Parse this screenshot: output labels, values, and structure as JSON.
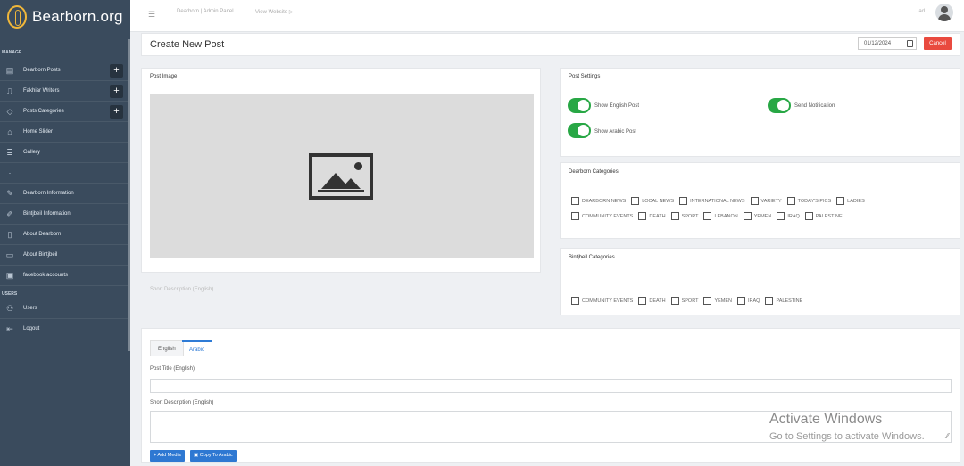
{
  "brand": {
    "name": "Bearborn.org"
  },
  "sidebar": {
    "section_manage": "MANAGE",
    "section_users": "USERS",
    "items": [
      {
        "label": "Dearborn Posts",
        "icon": "posts-icon",
        "has_add": true
      },
      {
        "label": "Fakhiar Writers",
        "icon": "writers-icon",
        "has_add": true
      },
      {
        "label": "Posts Categories",
        "icon": "tag-icon",
        "has_add": true
      },
      {
        "label": "Home Slider",
        "icon": "home-icon",
        "has_add": false
      },
      {
        "label": "Gallery",
        "icon": "gallery-icon",
        "has_add": false
      },
      {
        "label": "",
        "icon": "blank-icon",
        "has_add": false
      },
      {
        "label": "Dearborn Information",
        "icon": "info-icon",
        "has_add": false
      },
      {
        "label": "Bintjbeil Information",
        "icon": "info2-icon",
        "has_add": false
      },
      {
        "label": "About Dearborn",
        "icon": "about-icon",
        "has_add": false
      },
      {
        "label": "About Bintjbeil",
        "icon": "about2-icon",
        "has_add": false
      },
      {
        "label": "facebook accounts",
        "icon": "facebook-icon",
        "has_add": false
      }
    ],
    "users_items": [
      {
        "label": "Users",
        "icon": "users-icon"
      },
      {
        "label": "Logout",
        "icon": "logout-icon"
      }
    ]
  },
  "topbar": {
    "admin_panel": "Dearborn | Admin Panel",
    "view_website": "View Website",
    "user_initials": "ad"
  },
  "header": {
    "title": "Create New Post",
    "date_value": "01/12/2024",
    "cancel_label": "Cancel"
  },
  "post_image": {
    "title": "Post Image",
    "placeholder_icon": "image-placeholder-icon"
  },
  "post_settings": {
    "title": "Post Settings",
    "toggles": [
      {
        "label": "Show English Post",
        "on": true
      },
      {
        "label": "Send Notification",
        "on": true
      },
      {
        "label": "Show Arabic Post",
        "on": true
      }
    ]
  },
  "dearborn_categories": {
    "title": "Dearborn Categories",
    "row1": [
      "DEARBORN NEWS",
      "LOCAL NEWS",
      "INTERNATIONAL NEWS",
      "VARIETY",
      "TODAY'S PICS",
      "LADIES"
    ],
    "row2": [
      "COMMUNITY EVENTS",
      "DEATH",
      "SPORT",
      "LEBANON",
      "YEMEN",
      "IRAQ",
      "PALESTINE"
    ]
  },
  "bintjbeil_categories": {
    "title": "Bintjbeil Categories",
    "row1": [
      "COMMUNITY EVENTS",
      "DEATH",
      "SPORT",
      "YEMEN",
      "IRAQ",
      "PALESTINE"
    ]
  },
  "short_desc_faint": "Short Description (English)",
  "form": {
    "tabs": [
      "English",
      "Arabic"
    ],
    "post_title_label": "Post Title (English)",
    "short_desc_label": "Short Description (English)",
    "add_media_label": "+ Add Media",
    "copy_label": "Copy To Arabic"
  },
  "watermark": {
    "title": "Activate Windows",
    "subtitle": "Go to Settings to activate Windows."
  },
  "colors": {
    "sidebar": "#3a4b5d",
    "accent_green": "#28a745",
    "cancel_red": "#e94a3f",
    "primary_blue": "#2e78d2",
    "logo_gold": "#f0b73a"
  }
}
